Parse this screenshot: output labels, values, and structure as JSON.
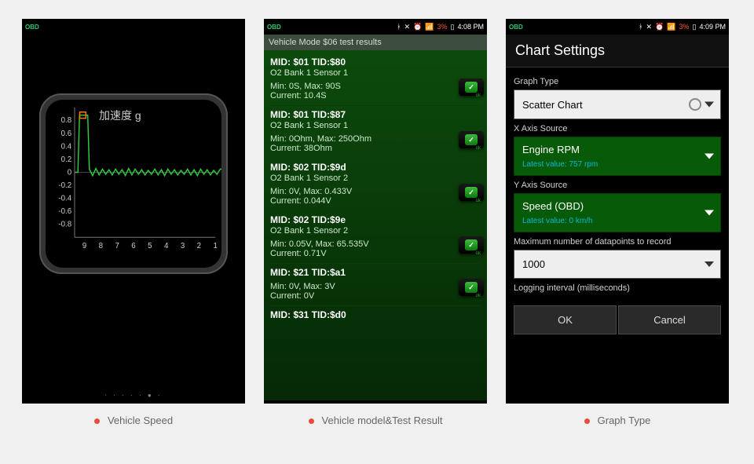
{
  "captions": [
    "Vehicle Speed",
    "Vehicle model&Test Result",
    "Graph Type"
  ],
  "panelA": {
    "status": {
      "battery": "",
      "time": ""
    },
    "chart_title": "加速度 g",
    "dots_count": 7,
    "dots_active_index": 5
  },
  "chart_data": {
    "type": "line",
    "title": "加速度 g",
    "xlabel": "",
    "ylabel": "g",
    "ylim": [
      -1.0,
      1.0
    ],
    "y_ticks": [
      0.8,
      0.6,
      0.4,
      0.2,
      0,
      -0.2,
      -0.4,
      -0.6,
      -0.8
    ],
    "x_ticks": [
      9,
      8,
      7,
      6,
      5,
      4,
      3,
      2,
      1
    ],
    "x": [
      9.6,
      9.5,
      9.4,
      9.3,
      9.2,
      9.1,
      9.0,
      8.9,
      8.8,
      8.7,
      8.5,
      8.3,
      8.1,
      7.9,
      7.7,
      7.5,
      7.3,
      7.1,
      6.9,
      6.7,
      6.5,
      6.3,
      6.1,
      5.9,
      5.7,
      5.5,
      5.3,
      5.1,
      4.9,
      4.7,
      4.5,
      4.3,
      4.1,
      3.9,
      3.7,
      3.5,
      3.3,
      3.1,
      2.9,
      2.7,
      2.5,
      2.3,
      2.1,
      1.9,
      1.7,
      1.5,
      1.3,
      1.1,
      0.9,
      0.7,
      0.5
    ],
    "values": [
      0.0,
      0.0,
      0.0,
      0.88,
      0.88,
      0.88,
      0.88,
      0.88,
      0.88,
      0.05,
      -0.05,
      0.06,
      -0.04,
      0.05,
      -0.03,
      0.04,
      -0.04,
      0.05,
      -0.03,
      0.04,
      -0.05,
      0.06,
      -0.04,
      0.05,
      -0.03,
      0.04,
      -0.04,
      0.03,
      -0.03,
      0.05,
      -0.04,
      0.04,
      -0.05,
      0.05,
      -0.03,
      0.04,
      -0.04,
      0.03,
      -0.03,
      0.05,
      -0.04,
      0.04,
      -0.05,
      0.05,
      -0.03,
      0.04,
      -0.04,
      0.03,
      -0.03,
      0.05,
      0.05
    ],
    "marker": {
      "x": 9.1,
      "y": 0.88,
      "color": "#ff7a00"
    }
  },
  "panelB": {
    "status": {
      "battery": "3%",
      "time": "4:08 PM"
    },
    "title": "Vehicle Mode $06 test results",
    "results": [
      {
        "mid": "MID: $01 TID:$80",
        "sub": "O2 Bank 1 Sensor 1",
        "min": "Min: 0S, Max: 90S",
        "cur": "Current: 10.4S",
        "ok": true
      },
      {
        "mid": "MID: $01 TID:$87",
        "sub": "O2 Bank 1 Sensor 1",
        "min": "Min: 0Ohm, Max: 250Ohm",
        "cur": "Current: 38Ohm",
        "ok": true
      },
      {
        "mid": "MID: $02 TID:$9d",
        "sub": "O2 Bank 1 Sensor 2",
        "min": "Min: 0V, Max: 0.433V",
        "cur": "Current: 0.044V",
        "ok": true
      },
      {
        "mid": "MID: $02 TID:$9e",
        "sub": "O2 Bank 1 Sensor 2",
        "min": "Min: 0.05V, Max: 65.535V",
        "cur": "Current: 0.71V",
        "ok": true
      },
      {
        "mid": "MID: $21 TID:$a1",
        "sub": "",
        "min": "Min: 0V, Max: 3V",
        "cur": "Current: 0V",
        "ok": true
      },
      {
        "mid": "MID: $31 TID:$d0",
        "sub": "",
        "min": "",
        "cur": "",
        "ok": false
      }
    ]
  },
  "panelC": {
    "status": {
      "battery": "3%",
      "time": "4:09 PM"
    },
    "appbar_title": "Chart Settings",
    "sections": {
      "graph_type": {
        "label": "Graph Type",
        "value": "Scatter Chart"
      },
      "x_source": {
        "label": "X Axis Source",
        "value": "Engine RPM",
        "latest": "Latest value: 757 rpm"
      },
      "y_source": {
        "label": "Y Axis Source",
        "value": "Speed (OBD)",
        "latest": "Latest value: 0 km/h"
      },
      "max_points": {
        "label": "Maximum number of datapoints to record",
        "value": "1000"
      },
      "log_interval": {
        "label": "Logging interval (milliseconds)"
      }
    },
    "buttons": {
      "ok": "OK",
      "cancel": "Cancel"
    }
  }
}
